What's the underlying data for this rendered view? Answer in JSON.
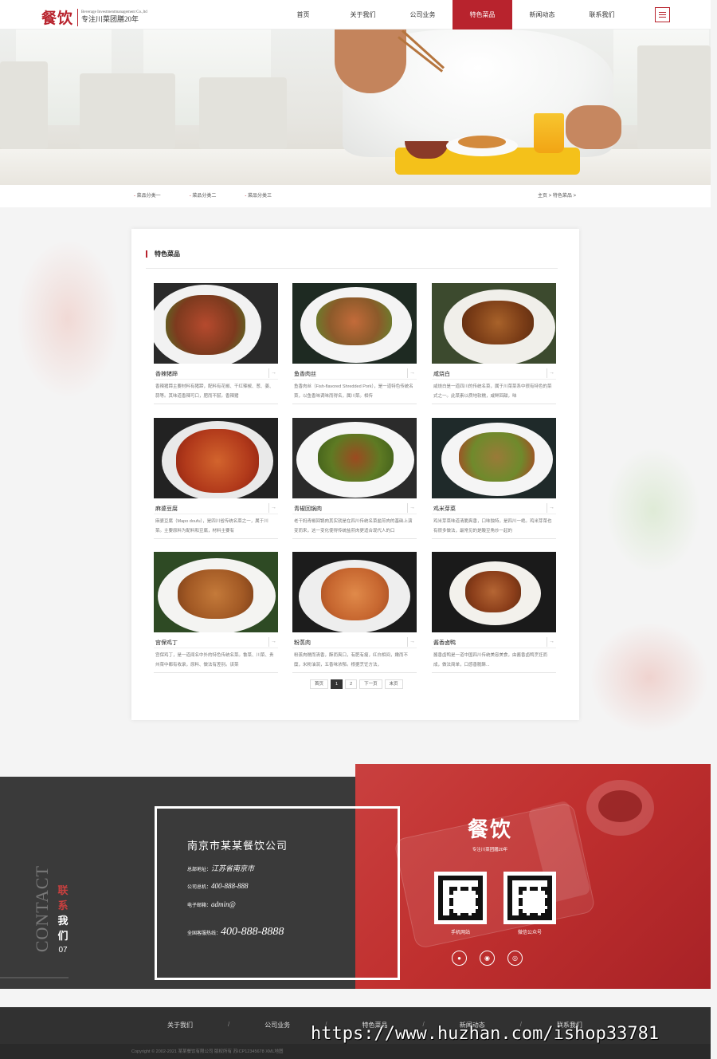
{
  "header": {
    "logo_mark": "餐饮",
    "logo_en": "Beverage Investmentmanagement Co.,ltd",
    "logo_cn": "专注川菜团膳20年",
    "nav": [
      "首页",
      "关于我们",
      "公司业务",
      "特色菜品",
      "新闻动态",
      "联系我们"
    ],
    "active_nav": "特色菜品",
    "menu_icon": "hamburger-icon"
  },
  "subnav": {
    "categories": [
      "菜品分类一",
      "菜品分类二",
      "菜品分类三"
    ],
    "breadcrumb": "主页 > 特色菜品 >"
  },
  "main": {
    "section_title": "特色菜品",
    "products": [
      {
        "name": "香辣猪蹄",
        "arrow": "→",
        "desc": "香辣猪蹄主要材料有猪蹄，配料有花椒、干红辣椒、葱、姜、蒜等。其味道香辣可口，肥而不腻。香辣猪"
      },
      {
        "name": "鱼香肉丝",
        "arrow": "→",
        "desc": "鱼香肉丝（Fish-flavored Shredded Pork），是一道特色传统名菜，以鱼香味调味而得名，属川菜。相传"
      },
      {
        "name": "咸烧白",
        "arrow": "→",
        "desc": "咸烧白是一道四川的传统名菜，属于川菜菜系中很有特色的菜式之一。此菜素以质地软糯，咸鲜回甜，味"
      },
      {
        "name": "麻婆豆腐",
        "arrow": "→",
        "desc": "麻婆豆腐（Mapo doufu），是四川省传统名菜之一，属于川菜。主要原料为配料和豆腐，材料主要有"
      },
      {
        "name": "青椒回锅肉",
        "arrow": "→",
        "desc": "老干妈青椒回锅肉其实就是在四川传统名菜盐煎肉的基础上演变而来，这一变化使得传统盐煎肉更适合现代人的口"
      },
      {
        "name": "鸡米芽菜",
        "arrow": "→",
        "desc": "鸡米芽菜味道清脆爽香，口味独特，是四川一绝。鸡米芽菜也有很多做法，最常见的是酸豆角炒一起的"
      },
      {
        "name": "宫保鸡丁",
        "arrow": "→",
        "desc": "宫保鸡丁，是一道闻名中外的特色传统名菜。鲁菜、川菜、贵州菜中都有收录，原料、做法有差别。该菜"
      },
      {
        "name": "粉蒸肉",
        "arrow": "→",
        "desc": "粉蒸肉糯而清香，酥而爽口，有肥有瘦，红白相间，嫩而不糜，米粉油润，五香味浓郁。根据烹饪方法，"
      },
      {
        "name": "酱香卤鸭",
        "arrow": "→",
        "desc": "酱香卤鸭是一道中国四川传统美容美食，由酱香卤鸭烹饪而成，做法简单，口感香脆酥..."
      }
    ],
    "pager": [
      "首页",
      "1",
      "2",
      "下一页",
      "末页"
    ],
    "pager_current": "1"
  },
  "contact": {
    "vertical_en": "CONTACT",
    "vertical_cn": [
      "联",
      "系",
      "我",
      "们"
    ],
    "vertical_num": "07",
    "company": "南京市某某餐饮公司",
    "address_label": "总部地址：",
    "address": "江苏省南京市",
    "phone_label": "公司总机：",
    "phone": "400-888-888",
    "email_label": "电子邮箱：",
    "email": "admin@",
    "hotline_label": "全国客服热线：",
    "hotline": "400-888-8888",
    "right_logo": "餐饮",
    "right_sub": "专注川菜团膳20年",
    "qr_mobile_label": "手机网站",
    "qr_wechat_label": "微信公众号",
    "social_icons": [
      "qq-icon",
      "wechat-icon",
      "weibo-icon"
    ]
  },
  "footer": {
    "nav": [
      "关于我们",
      "公司业务",
      "特色菜品",
      "新闻动态",
      "联系我们"
    ],
    "separator": "/",
    "copyright": "Copyright © 2002-2021 某某餐饮有限公司 版权所有 苏ICP12345678 XML地图",
    "watermark": "https://www.huzhan.com/ishop33781"
  },
  "colors": {
    "brand": "#b8232d",
    "dark": "#3a3a3a",
    "red_panel": "#c0302f"
  }
}
